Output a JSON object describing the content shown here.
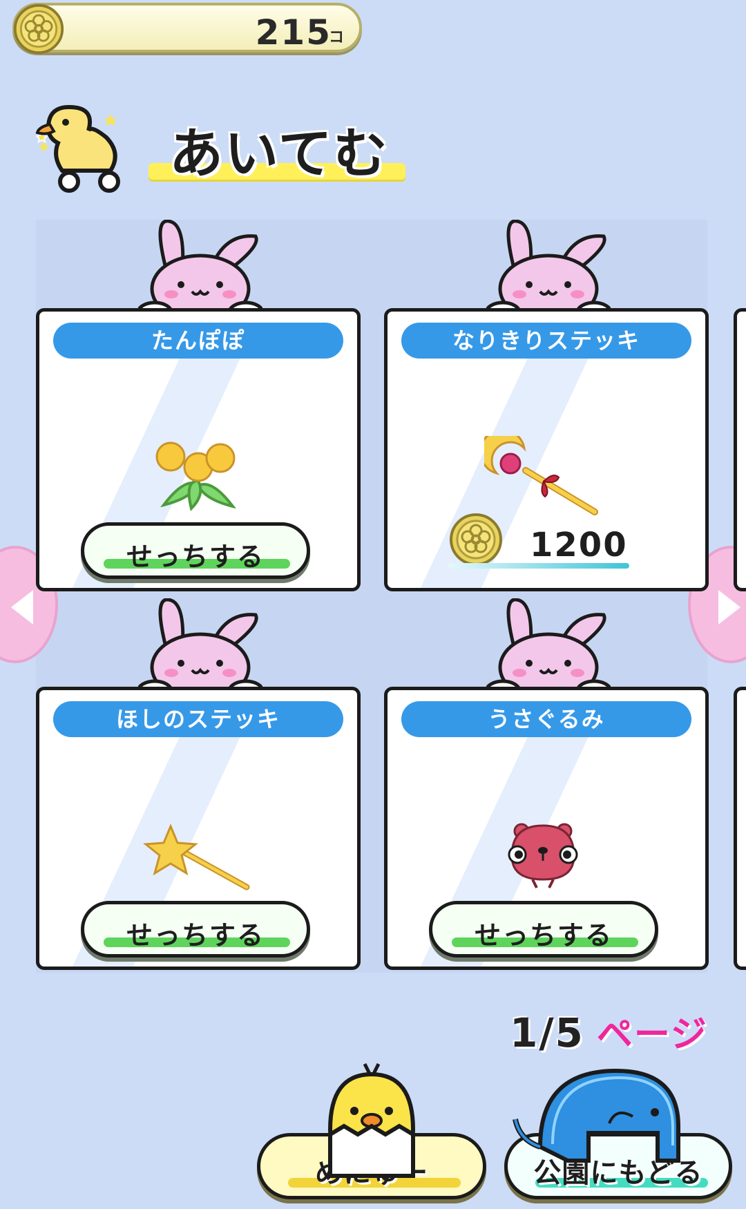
{
  "coins": {
    "count": "215",
    "unit": "コ"
  },
  "title": "あいてむ",
  "items": [
    {
      "name": "たんぽぽ",
      "icon": "dandelion-icon",
      "state": "owned",
      "button_label": "せっちする"
    },
    {
      "name": "なりきりステッキ",
      "icon": "magic-wand-icon",
      "state": "for_sale",
      "price": "1200"
    },
    {
      "name": "ほしのステッキ",
      "icon": "star-wand-icon",
      "state": "owned",
      "button_label": "せっちする"
    },
    {
      "name": "うさぐるみ",
      "icon": "red-plush-icon",
      "state": "owned",
      "button_label": "せっちする"
    }
  ],
  "pagination": {
    "page_number": "1/5",
    "page_label": "ページ"
  },
  "bottom_nav": {
    "menu_label": "めにゅー",
    "back_label": "公園にもどる"
  },
  "colors": {
    "background": "#ccdcf6",
    "name_bar": "#3699e8",
    "accent_pink": "#f0269c",
    "arrow": "#f6bde0"
  }
}
